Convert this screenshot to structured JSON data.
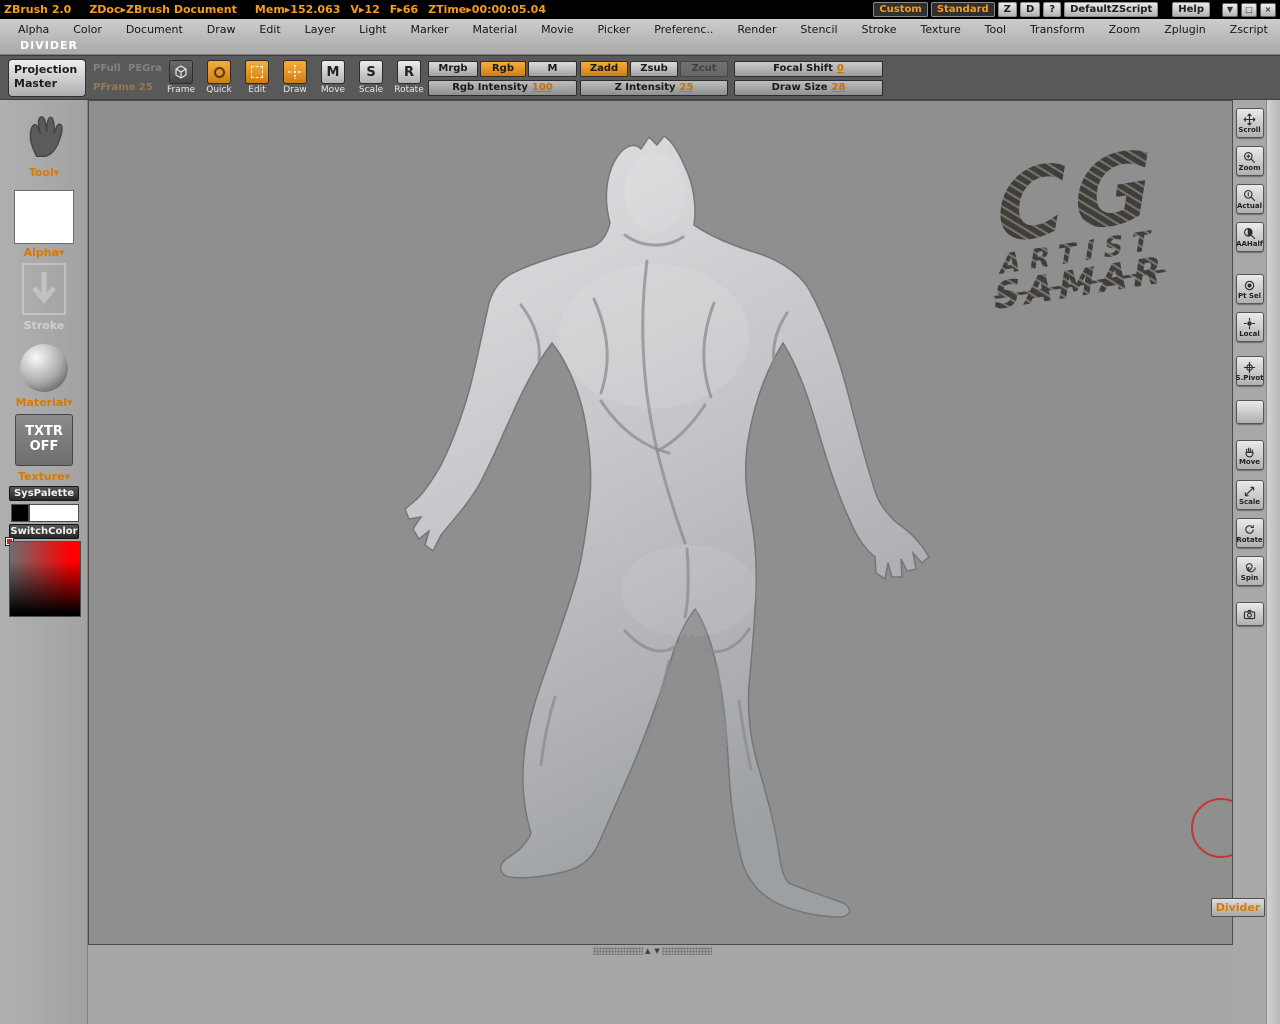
{
  "colors": {
    "accent_orange": "#f49d1b",
    "canvas_bg": "#8f8f8f"
  },
  "titlebar": {
    "app_title": "ZBrush 2.0",
    "zdoc": "ZDoc▸ZBrush Document",
    "mem": "Mem▸152.063",
    "v": "V▸12",
    "f": "F▸66",
    "ztime": "ZTime▸00:00:05.04",
    "custom": "Custom",
    "standard": "Standard",
    "z": "Z",
    "d": "D",
    "question": "?",
    "default_zscript": "DefaultZScript",
    "help": "Help",
    "minimize_icon": "▼",
    "restore_icon": "□",
    "close_icon": "×"
  },
  "menu": {
    "items": [
      "Alpha",
      "Color",
      "Document",
      "Draw",
      "Edit",
      "Layer",
      "Light",
      "Marker",
      "Material",
      "Movie",
      "Picker",
      "Preferenc..",
      "Render",
      "Stencil",
      "Stroke",
      "Texture",
      "Tool",
      "Transform",
      "Zoom",
      "Zplugin",
      "Zscript"
    ],
    "divider_caption": "DIVIDER"
  },
  "toolbar": {
    "projection_master": "Projection Master",
    "pfull": "PFull",
    "pegra": "PEGra",
    "pframe": "PFrame 25",
    "frame": "Frame",
    "quick": "Quick",
    "edit": "Edit",
    "draw": "Draw",
    "move": "Move",
    "scale": "Scale",
    "rotate": "Rotate",
    "move_icon_letter": "M",
    "scale_icon_letter": "S",
    "rotate_icon_letter": "R",
    "mrgb": "Mrgb",
    "rgb": "Rgb",
    "m": "M",
    "zadd": "Zadd",
    "zsub": "Zsub",
    "zcut": "Zcut",
    "rgb_intensity_label": "Rgb Intensity",
    "rgb_intensity_value": "100",
    "z_intensity_label": "Z Intensity",
    "z_intensity_value": "25",
    "focal_shift_label": "Focal Shift",
    "focal_shift_value": "0",
    "draw_size_label": "Draw Size",
    "draw_size_value": "28"
  },
  "left_panel": {
    "tool_label": "Tool",
    "alpha_label": "Alpha",
    "stroke_label": "Stroke",
    "material_label": "Material",
    "txtr_line1": "TXTR",
    "txtr_line2": "OFF",
    "texture_label": "Texture",
    "syspalette": "SysPalette",
    "switchcolor": "SwitchColor",
    "dropdown_arrow_icon": "▼"
  },
  "right_panel": {
    "items": [
      {
        "name": "scroll-button",
        "label": "Scroll",
        "icon": "scroll-hand-icon",
        "gap": 8
      },
      {
        "name": "zoom-button",
        "label": "Zoom",
        "icon": "zoom-magnifier-icon",
        "gap": 8
      },
      {
        "name": "actual-button",
        "label": "Actual",
        "icon": "actual-size-icon",
        "gap": 8
      },
      {
        "name": "aahalf-button",
        "label": "AAHalf",
        "icon": "aa-half-icon",
        "gap": 8
      },
      {
        "name": "point-select-button",
        "label": "Pt Sel",
        "icon": "point-select-icon",
        "gap": 22
      },
      {
        "name": "local-button",
        "label": "Local",
        "icon": "local-pivot-icon",
        "gap": 8
      },
      {
        "name": "set-pivot-button",
        "label": "S.Pivot",
        "icon": "set-pivot-icon",
        "gap": 14
      },
      {
        "name": "blank-button",
        "label": "",
        "icon": "blank",
        "gap": 14
      },
      {
        "name": "move-button",
        "label": "Move",
        "icon": "move-hand-icon",
        "gap": 16
      },
      {
        "name": "scale-button",
        "label": "Scale",
        "icon": "scale-icon",
        "gap": 10
      },
      {
        "name": "rotate-button",
        "label": "Rotate",
        "icon": "rotate-icon",
        "gap": 8
      },
      {
        "name": "spin-button",
        "label": "Spin",
        "icon": "spin-icon",
        "gap": 8
      },
      {
        "name": "snapshot-button",
        "label": "",
        "icon": "camera-icon",
        "gap": 16
      }
    ]
  },
  "canvas": {
    "logo_line1": "CG",
    "logo_line2": "ARTIST",
    "logo_line3": "SAMAR",
    "divider_button": "Divider",
    "scroll_up_icon": "▲",
    "scroll_down_icon": "▼"
  }
}
